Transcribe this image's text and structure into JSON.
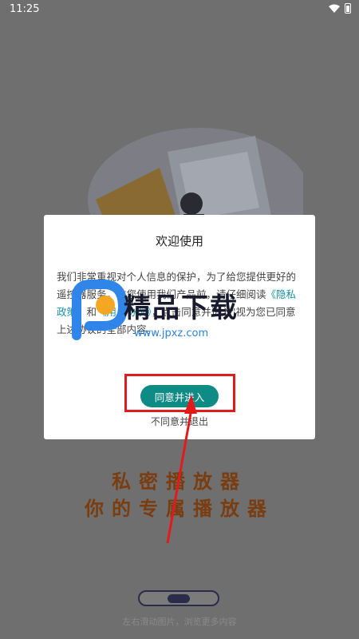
{
  "status_bar": {
    "time": "11:25"
  },
  "dialog": {
    "title": "欢迎使用",
    "body_part1": "我们非常重视对个人信息的保护，为了给您提供更好的遥控器服务，在您使用我们产品前，请仔细阅读",
    "privacy_link": "《隐私政策》",
    "body_part2": "和",
    "user_link": "《用户协议》",
    "body_part3": "，点击同意并进入\"视为您已同意上述协议的全部内容。",
    "agree_label": "同意并进入",
    "disagree_label": "不同意并退出"
  },
  "background": {
    "slogan_line1": "私密播放器",
    "slogan_line2": "你的专属播放器",
    "hint": "左右滑动图片，浏览更多内容"
  },
  "watermark": {
    "text": "精品下载",
    "url": "www.jpxz.com"
  },
  "colors": {
    "accent": "#0f8b86",
    "highlight": "#e11b1b",
    "link": "#1a8fa5"
  }
}
